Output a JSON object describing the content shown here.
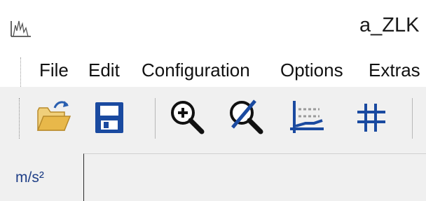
{
  "window": {
    "title": "a_ZLK"
  },
  "menu": {
    "items": [
      {
        "id": "file",
        "label": "File"
      },
      {
        "id": "edit",
        "label": "Edit"
      },
      {
        "id": "configuration",
        "label": "Configuration"
      },
      {
        "id": "options",
        "label": "Options"
      },
      {
        "id": "extras",
        "label": "Extras"
      }
    ]
  },
  "toolbar": {
    "buttons": [
      {
        "icon": "open-folder-icon"
      },
      {
        "icon": "save-icon"
      },
      {
        "icon": "zoom-in-icon"
      },
      {
        "icon": "zoom-reset-icon"
      },
      {
        "icon": "chart-fit-icon"
      },
      {
        "icon": "grid-icon"
      }
    ]
  },
  "plot": {
    "y_unit": "m/s²"
  },
  "colors": {
    "accent_blue": "#1a4aa0",
    "folder_yellow": "#e8c15a",
    "unit_text": "#1f3f87"
  }
}
